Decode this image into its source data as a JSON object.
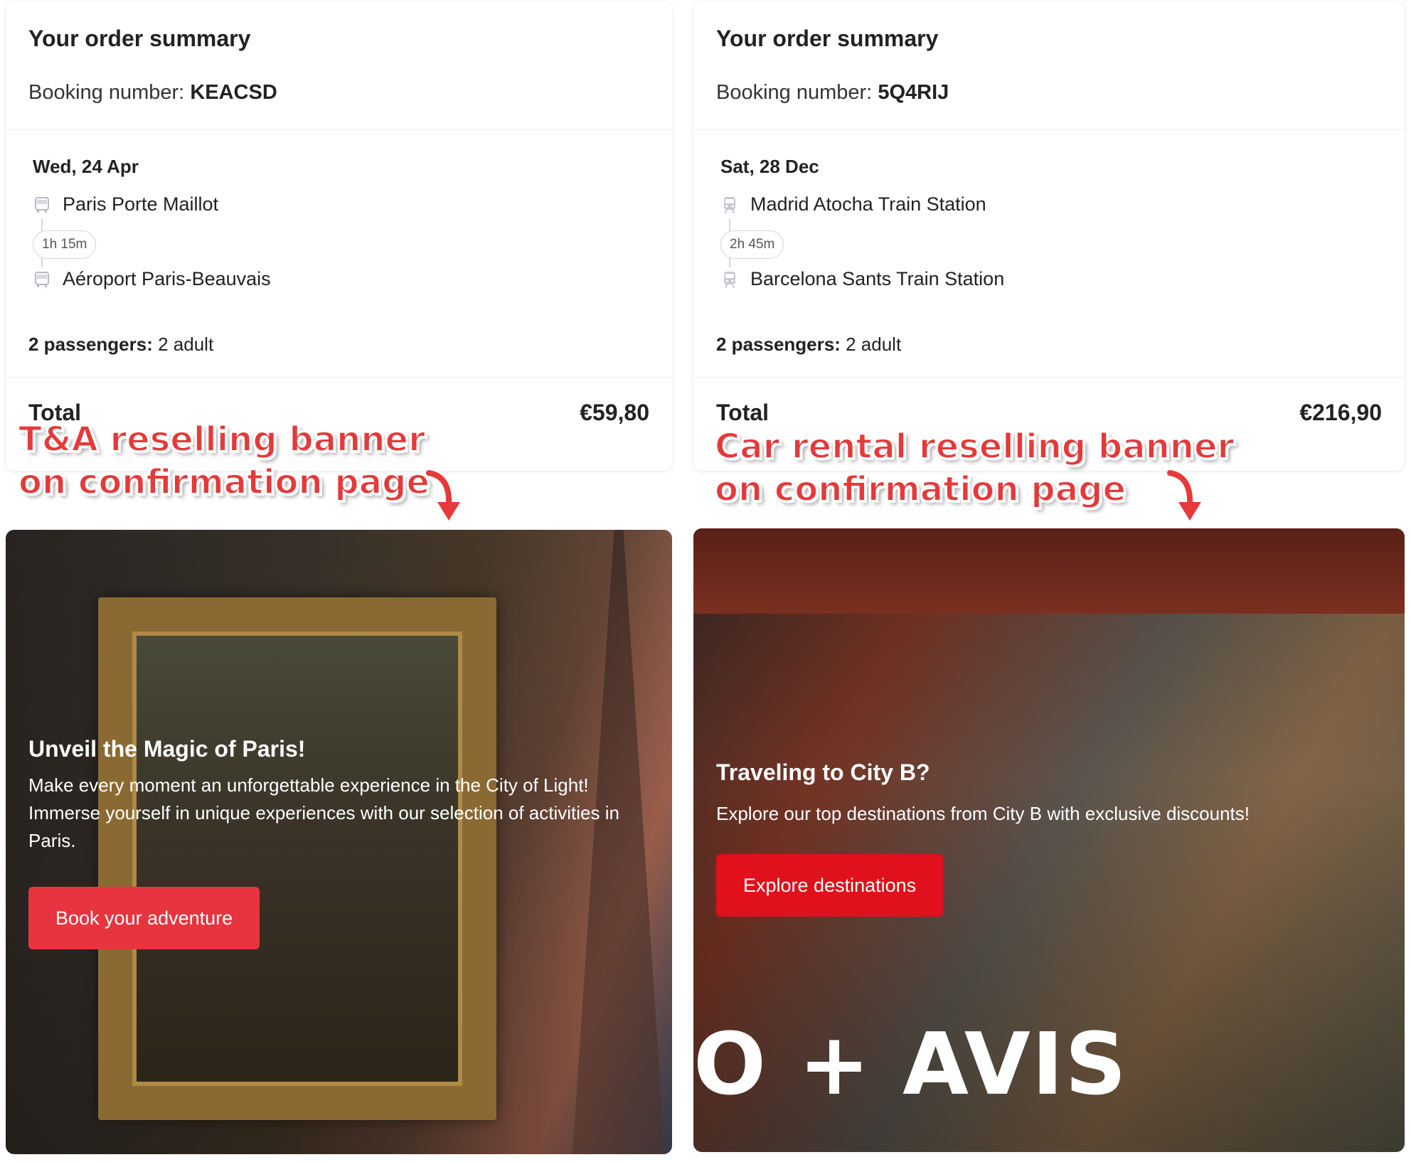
{
  "left": {
    "summary_title": "Your order summary",
    "booking_label": "Booking number:",
    "booking_number": "KEACSD",
    "date": "Wed, 24 Apr",
    "from": "Paris Porte Maillot",
    "duration": "1h 15m",
    "to": "Aéroport Paris-Beauvais",
    "passengers_label": "2 passengers:",
    "passengers_value": "2 adult",
    "total_label": "Total",
    "total_value": "€59,80",
    "transport_icon": "bus-icon",
    "annotation_line1": "T&A reselling banner",
    "annotation_line2": "on confirmation page",
    "banner": {
      "title": "Unveil the Magic of Paris!",
      "text": "Make every moment an unforgettable experience in the City of Light! Immerse yourself in unique experiences with our selection of activities in Paris.",
      "button": "Book your adventure",
      "button_color": "#e8343f"
    }
  },
  "right": {
    "summary_title": "Your order summary",
    "booking_label": "Booking number:",
    "booking_number": "5Q4RIJ",
    "date": "Sat, 28 Dec",
    "from": "Madrid Atocha Train Station",
    "duration": "2h 45m",
    "to": "Barcelona Sants Train Station",
    "passengers_label": "2 passengers:",
    "passengers_value": "2 adult",
    "total_label": "Total",
    "total_value": "€216,90",
    "transport_icon": "train-icon",
    "annotation_line1": "Car rental reselling banner",
    "annotation_line2": "on confirmation page",
    "banner": {
      "title": "Traveling to City B?",
      "text": "Explore our top destinations from City B with exclusive discounts!",
      "button": "Explore destinations",
      "button_color": "#e0111c",
      "brand_text": "O + AVIS"
    }
  },
  "colors": {
    "annotation": "#e5393a"
  }
}
